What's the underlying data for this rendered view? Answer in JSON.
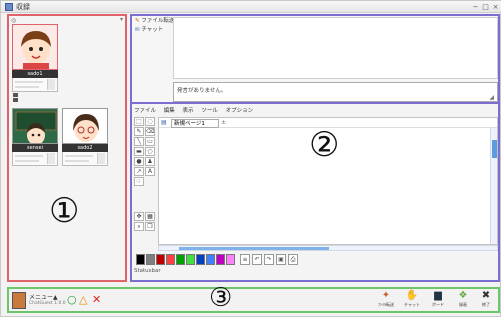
{
  "window": {
    "title": "収録"
  },
  "left_panel": {
    "users": [
      {
        "name": "sado1"
      },
      {
        "name": "sensei"
      },
      {
        "name": "sado2"
      }
    ],
    "marker": "①"
  },
  "chat": {
    "tabs": [
      "ファイル転送",
      "チャット"
    ],
    "input_text": "発言がありません。",
    "marker": "②"
  },
  "editor": {
    "menu": [
      "ファイル",
      "編集",
      "表示",
      "ツール",
      "オプション"
    ],
    "doc_tab": "新規ページ1",
    "status": "Statusbar"
  },
  "bottom": {
    "menu_label": "メニュー▲",
    "version": "ChatGuest 1.0.0",
    "marker": "③",
    "actions": [
      {
        "icon": "transfer-icon",
        "label": "ﾌｧｲﾙ転送"
      },
      {
        "icon": "hand-icon",
        "label": "チャット"
      },
      {
        "icon": "board-icon",
        "label": "ボード"
      },
      {
        "icon": "record-icon",
        "label": "録画"
      },
      {
        "icon": "exit-icon",
        "label": "終了"
      }
    ]
  },
  "palette": [
    "#000000",
    "#7f7f7f",
    "#c00000",
    "#ff4040",
    "#00a000",
    "#40e040",
    "#0040c0",
    "#4080ff",
    "#c000c0",
    "#ff80ff"
  ],
  "colors": {
    "left_border": "#e0636b",
    "right_border": "#7a6fd0",
    "bottom_border": "#6cc46b"
  }
}
